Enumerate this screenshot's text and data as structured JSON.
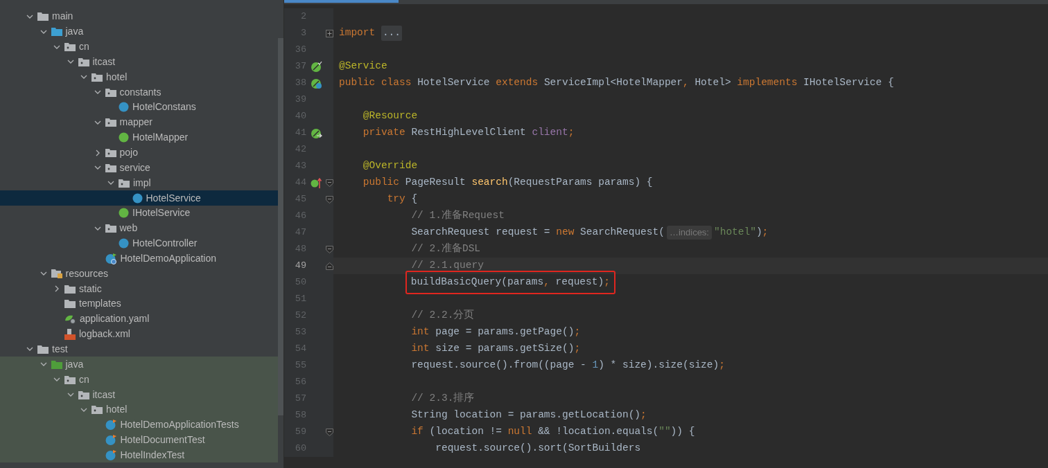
{
  "project_tree": [
    {
      "label": "main",
      "kind": "folder",
      "expanded": true,
      "selected": false,
      "tinted": false,
      "children": [
        {
          "label": "java",
          "kind": "source_folder",
          "expanded": true,
          "selected": false,
          "tinted": false,
          "children": [
            {
              "label": "cn",
              "kind": "package",
              "expanded": true,
              "selected": false,
              "tinted": false,
              "children": [
                {
                  "label": "itcast",
                  "kind": "package",
                  "expanded": true,
                  "selected": false,
                  "tinted": false,
                  "children": [
                    {
                      "label": "hotel",
                      "kind": "package",
                      "expanded": true,
                      "selected": false,
                      "tinted": false,
                      "children": [
                        {
                          "label": "constants",
                          "kind": "package",
                          "expanded": true,
                          "selected": false,
                          "tinted": false,
                          "children": [
                            {
                              "label": "HotelConstans",
                              "kind": "class",
                              "selected": false,
                              "tinted": false
                            }
                          ]
                        },
                        {
                          "label": "mapper",
                          "kind": "package",
                          "expanded": true,
                          "selected": false,
                          "tinted": false,
                          "children": [
                            {
                              "label": "HotelMapper",
                              "kind": "interface",
                              "selected": false,
                              "tinted": false
                            }
                          ]
                        },
                        {
                          "label": "pojo",
                          "kind": "package",
                          "expanded": false,
                          "selected": false,
                          "tinted": false
                        },
                        {
                          "label": "service",
                          "kind": "package",
                          "expanded": true,
                          "selected": false,
                          "tinted": false,
                          "children": [
                            {
                              "label": "impl",
                              "kind": "package",
                              "expanded": true,
                              "selected": false,
                              "tinted": false,
                              "children": [
                                {
                                  "label": "HotelService",
                                  "kind": "class",
                                  "selected": true,
                                  "tinted": false
                                }
                              ]
                            },
                            {
                              "label": "IHotelService",
                              "kind": "interface",
                              "selected": false,
                              "tinted": false
                            }
                          ]
                        },
                        {
                          "label": "web",
                          "kind": "package",
                          "expanded": true,
                          "selected": false,
                          "tinted": false,
                          "children": [
                            {
                              "label": "HotelController",
                              "kind": "class",
                              "selected": false,
                              "tinted": false
                            }
                          ]
                        },
                        {
                          "label": "HotelDemoApplication",
                          "kind": "spring_app",
                          "selected": false,
                          "tinted": false
                        }
                      ]
                    }
                  ]
                }
              ]
            }
          ]
        },
        {
          "label": "resources",
          "kind": "resource_folder",
          "expanded": true,
          "selected": false,
          "tinted": false,
          "children": [
            {
              "label": "static",
              "kind": "folder",
              "expanded": false,
              "selected": false,
              "tinted": false
            },
            {
              "label": "templates",
              "kind": "folder",
              "selected": false,
              "tinted": false
            },
            {
              "label": "application.yaml",
              "kind": "yaml",
              "selected": false,
              "tinted": false
            },
            {
              "label": "logback.xml",
              "kind": "xml",
              "selected": false,
              "tinted": false
            }
          ]
        }
      ]
    },
    {
      "label": "test",
      "kind": "folder",
      "expanded": true,
      "selected": false,
      "tinted": false,
      "children": [
        {
          "label": "java",
          "kind": "test_folder",
          "expanded": true,
          "selected": false,
          "tinted": true,
          "children": [
            {
              "label": "cn",
              "kind": "package",
              "expanded": true,
              "selected": false,
              "tinted": true,
              "children": [
                {
                  "label": "itcast",
                  "kind": "package",
                  "expanded": true,
                  "selected": false,
                  "tinted": true,
                  "children": [
                    {
                      "label": "hotel",
                      "kind": "package",
                      "expanded": true,
                      "selected": false,
                      "tinted": true,
                      "children": [
                        {
                          "label": "HotelDemoApplicationTests",
                          "kind": "test_class",
                          "selected": false,
                          "tinted": true
                        },
                        {
                          "label": "HotelDocumentTest",
                          "kind": "test_class",
                          "selected": false,
                          "tinted": true
                        },
                        {
                          "label": "HotelIndexTest",
                          "kind": "test_class",
                          "selected": false,
                          "tinted": true
                        }
                      ]
                    }
                  ]
                }
              ]
            }
          ]
        }
      ]
    }
  ],
  "editor": {
    "lines": [
      {
        "number": "2",
        "current": false,
        "boxed": false
      },
      {
        "number": "3",
        "current": false,
        "boxed": false,
        "fold": {
          "kind": "collapsed"
        },
        "tokens": [
          {
            "kind": "keyword",
            "text": "import "
          },
          {
            "kind": "folded",
            "text": "..."
          }
        ]
      },
      {
        "number": "36",
        "current": false,
        "boxed": false
      },
      {
        "number": "37",
        "current": false,
        "boxed": false,
        "gutter_icon": {
          "kind": "bean"
        },
        "tokens": [
          {
            "kind": "annotation",
            "text": "@Service"
          }
        ]
      },
      {
        "number": "38",
        "current": false,
        "boxed": false,
        "gutter_icon": {
          "kind": "bean_class"
        },
        "tokens": [
          {
            "kind": "keyword",
            "text": "public class "
          },
          {
            "kind": "plain",
            "text": "HotelService "
          },
          {
            "kind": "keyword",
            "text": "extends "
          },
          {
            "kind": "plain",
            "text": "ServiceImpl<HotelMapper"
          },
          {
            "kind": "keyword",
            "text": ", "
          },
          {
            "kind": "plain",
            "text": "Hotel> "
          },
          {
            "kind": "keyword",
            "text": "implements "
          },
          {
            "kind": "plain",
            "text": "IHotelService {"
          }
        ]
      },
      {
        "number": "39",
        "current": false,
        "boxed": false
      },
      {
        "number": "40",
        "current": false,
        "boxed": false,
        "tokens": [
          {
            "kind": "annotation",
            "text": "    @Resource"
          }
        ]
      },
      {
        "number": "41",
        "current": false,
        "boxed": false,
        "gutter_icon": {
          "kind": "inject"
        },
        "tokens": [
          {
            "kind": "keyword",
            "text": "    private "
          },
          {
            "kind": "plain",
            "text": "RestHighLevelClient "
          },
          {
            "kind": "field",
            "text": "client"
          },
          {
            "kind": "keyword",
            "text": ";"
          }
        ]
      },
      {
        "number": "42",
        "current": false,
        "boxed": false
      },
      {
        "number": "43",
        "current": false,
        "boxed": false,
        "tokens": [
          {
            "kind": "annotation",
            "text": "    @Override"
          }
        ]
      },
      {
        "number": "44",
        "current": false,
        "boxed": false,
        "gutter_icon": {
          "kind": "implements"
        },
        "fold": {
          "kind": "open"
        },
        "tokens": [
          {
            "kind": "keyword",
            "text": "    public "
          },
          {
            "kind": "plain",
            "text": "PageResult "
          },
          {
            "kind": "method",
            "text": "search"
          },
          {
            "kind": "plain",
            "text": "(RequestParams params) {"
          }
        ]
      },
      {
        "number": "45",
        "current": false,
        "boxed": false,
        "fold": {
          "kind": "open"
        },
        "tokens": [
          {
            "kind": "keyword",
            "text": "        try "
          },
          {
            "kind": "plain",
            "text": "{"
          }
        ]
      },
      {
        "number": "46",
        "current": false,
        "boxed": false,
        "tokens": [
          {
            "kind": "comment",
            "text": "            // 1.准备Request"
          }
        ]
      },
      {
        "number": "47",
        "current": false,
        "boxed": false,
        "tokens": [
          {
            "kind": "plain",
            "text": "            SearchRequest request = "
          },
          {
            "kind": "keyword",
            "text": "new "
          },
          {
            "kind": "plain",
            "text": "SearchRequest("
          },
          {
            "kind": "hint",
            "text": "…indices:"
          },
          {
            "kind": "string",
            "text": "\"hotel\""
          },
          {
            "kind": "plain",
            "text": ")"
          },
          {
            "kind": "keyword",
            "text": ";"
          }
        ]
      },
      {
        "number": "48",
        "current": false,
        "boxed": false,
        "fold": {
          "kind": "open"
        },
        "tokens": [
          {
            "kind": "comment",
            "text": "            // 2.准备DSL"
          }
        ]
      },
      {
        "number": "49",
        "current": true,
        "boxed": false,
        "fold": {
          "kind": "close"
        },
        "tokens": [
          {
            "kind": "comment",
            "text": "            // 2.1.query"
          }
        ]
      },
      {
        "number": "50",
        "current": false,
        "boxed": true,
        "tokens": [
          {
            "kind": "plain",
            "text": "            buildBasicQuery(params"
          },
          {
            "kind": "keyword",
            "text": ", "
          },
          {
            "kind": "plain",
            "text": "request)"
          },
          {
            "kind": "keyword",
            "text": ";"
          }
        ]
      },
      {
        "number": "51",
        "current": false,
        "boxed": false
      },
      {
        "number": "52",
        "current": false,
        "boxed": false,
        "tokens": [
          {
            "kind": "comment",
            "text": "            // 2.2.分页"
          }
        ]
      },
      {
        "number": "53",
        "current": false,
        "boxed": false,
        "tokens": [
          {
            "kind": "keyword",
            "text": "            int "
          },
          {
            "kind": "plain",
            "text": "page = params.getPage()"
          },
          {
            "kind": "keyword",
            "text": ";"
          }
        ]
      },
      {
        "number": "54",
        "current": false,
        "boxed": false,
        "tokens": [
          {
            "kind": "keyword",
            "text": "            int "
          },
          {
            "kind": "plain",
            "text": "size = params.getSize()"
          },
          {
            "kind": "keyword",
            "text": ";"
          }
        ]
      },
      {
        "number": "55",
        "current": false,
        "boxed": false,
        "tokens": [
          {
            "kind": "plain",
            "text": "            request.source().from((page - "
          },
          {
            "kind": "number",
            "text": "1"
          },
          {
            "kind": "plain",
            "text": ") * size).size(size)"
          },
          {
            "kind": "keyword",
            "text": ";"
          }
        ]
      },
      {
        "number": "56",
        "current": false,
        "boxed": false
      },
      {
        "number": "57",
        "current": false,
        "boxed": false,
        "tokens": [
          {
            "kind": "comment",
            "text": "            // 2.3.排序"
          }
        ]
      },
      {
        "number": "58",
        "current": false,
        "boxed": false,
        "tokens": [
          {
            "kind": "plain",
            "text": "            String location = params.getLocation()"
          },
          {
            "kind": "keyword",
            "text": ";"
          }
        ]
      },
      {
        "number": "59",
        "current": false,
        "boxed": false,
        "fold": {
          "kind": "open"
        },
        "tokens": [
          {
            "kind": "keyword",
            "text": "            if "
          },
          {
            "kind": "plain",
            "text": "(location != "
          },
          {
            "kind": "keyword",
            "text": "null "
          },
          {
            "kind": "plain",
            "text": "&& !location.equals("
          },
          {
            "kind": "string",
            "text": "\"\""
          },
          {
            "kind": "plain",
            "text": ")) {"
          }
        ]
      },
      {
        "number": "60",
        "current": false,
        "boxed": false,
        "tokens": [
          {
            "kind": "plain",
            "text": "                request.source().sort(SortBuilders"
          }
        ]
      }
    ]
  }
}
